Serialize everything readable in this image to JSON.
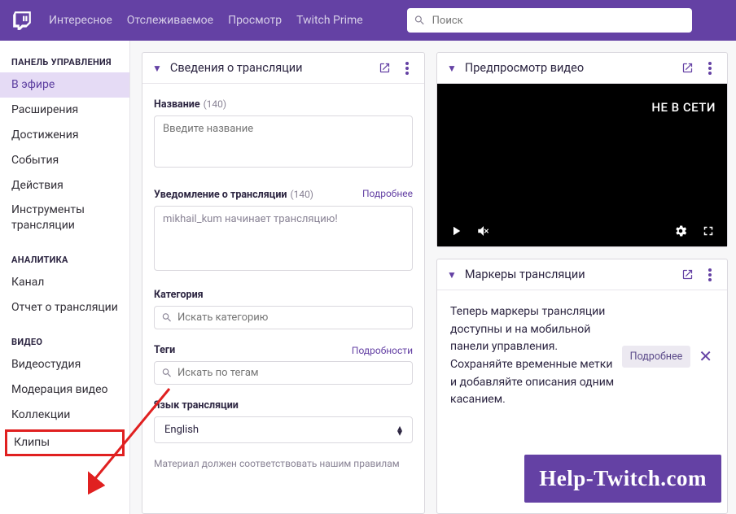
{
  "topbar": {
    "nav": [
      "Интересное",
      "Отслеживаемое",
      "Просмотр",
      "Twitch Prime"
    ],
    "search_placeholder": "Поиск"
  },
  "sidebar": {
    "sections": [
      {
        "title": "ПАНЕЛЬ УПРАВЛЕНИЯ",
        "items": [
          {
            "label": "В эфире",
            "active": true
          },
          {
            "label": "Расширения"
          },
          {
            "label": "Достижения"
          },
          {
            "label": "События"
          },
          {
            "label": "Действия"
          },
          {
            "label": "Инструменты трансляции"
          }
        ]
      },
      {
        "title": "АНАЛИТИКА",
        "items": [
          {
            "label": "Канал"
          },
          {
            "label": "Отчет о трансляции"
          }
        ]
      },
      {
        "title": "ВИДЕО",
        "items": [
          {
            "label": "Видеостудия"
          },
          {
            "label": "Модерация видео"
          },
          {
            "label": "Коллекции"
          },
          {
            "label": "Клипы",
            "highlighted": true
          }
        ]
      }
    ]
  },
  "stream_info": {
    "panel_title": "Сведения о трансляции",
    "title_label": "Название",
    "title_hint": "(140)",
    "title_placeholder": "Введите название",
    "notify_label": "Уведомление о трансляции",
    "notify_hint": "(140)",
    "notify_link": "Подробнее",
    "notify_value": "mikhail_kum начинает трансляцию!",
    "category_label": "Категория",
    "category_placeholder": "Искать категорию",
    "tags_label": "Теги",
    "tags_link": "Подробности",
    "tags_placeholder": "Искать по тегам",
    "language_label": "Язык трансляции",
    "language_value": "English",
    "footer_note": "Материал должен соответствовать нашим правилам"
  },
  "preview": {
    "panel_title": "Предпросмотр видео",
    "offline": "НЕ В СЕТИ"
  },
  "markers": {
    "panel_title": "Маркеры трансляции",
    "text": "Теперь маркеры трансляции доступны и на мобильной панели управления. Сохраняйте временные метки и добавляйте описания одним касанием.",
    "button": "Подробнее"
  },
  "watermark": "Help-Twitch.com"
}
